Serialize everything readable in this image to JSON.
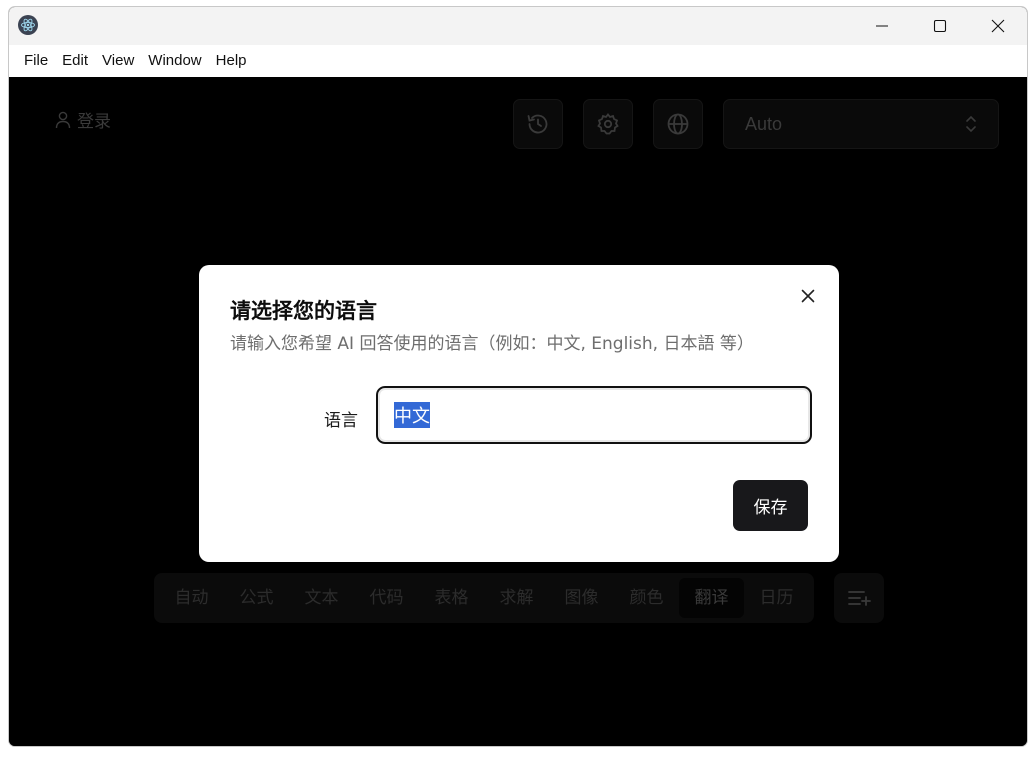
{
  "menu": [
    "File",
    "Edit",
    "View",
    "Window",
    "Help"
  ],
  "toolbar": {
    "login_label": "登录",
    "model_select": "Auto"
  },
  "modes": [
    {
      "label": "自动",
      "active": false
    },
    {
      "label": "公式",
      "active": false
    },
    {
      "label": "文本",
      "active": false
    },
    {
      "label": "代码",
      "active": false
    },
    {
      "label": "表格",
      "active": false
    },
    {
      "label": "求解",
      "active": false
    },
    {
      "label": "图像",
      "active": false
    },
    {
      "label": "颜色",
      "active": false
    },
    {
      "label": "翻译",
      "active": true
    },
    {
      "label": "日历",
      "active": false
    }
  ],
  "dialog": {
    "title": "请选择您的语言",
    "description": "请输入您希望 AI 回答使用的语言（例如：中文, English, 日本語 等）",
    "field_label": "语言",
    "field_value": "中文",
    "save_label": "保存"
  },
  "icons": {
    "app": "electron-atom-icon",
    "history": "history-icon",
    "settings": "gear-icon",
    "language": "globe-icon"
  },
  "colors": {
    "primary_button": "#18181b",
    "selection": "#3369d6"
  }
}
